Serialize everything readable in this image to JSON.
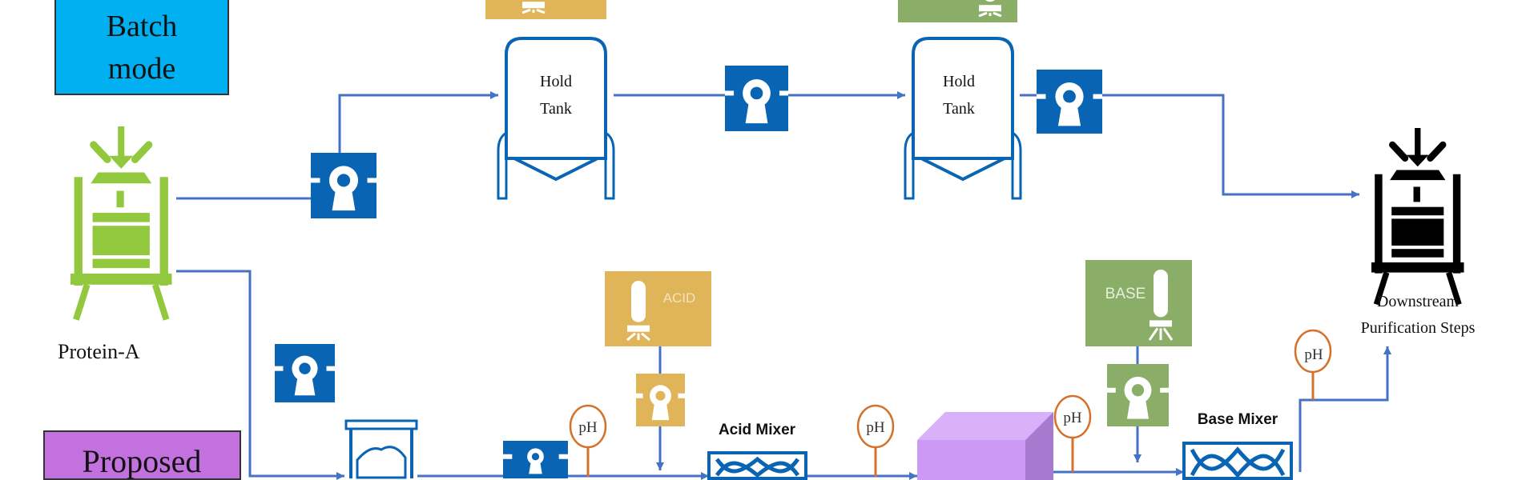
{
  "labels": {
    "batch_mode": [
      "Batch",
      "mode"
    ],
    "proposed": "Proposed",
    "protein_a": "Protein-A",
    "hold_tank": [
      "Hold",
      "Tank"
    ],
    "downstream": [
      "Downstream",
      "Purification Steps"
    ],
    "acid": "ACID",
    "base": "BASE",
    "acid_mixer": "Acid Mixer",
    "base_mixer": "Base Mixer",
    "ph": "pH"
  },
  "colors": {
    "batch_box": "#00b0f0",
    "proposed_box": "#c471e0",
    "pump_blue": "#0a64b4",
    "line_blue": "#4472c4",
    "acid_gold": "#e0b55a",
    "base_green": "#8aae68",
    "protein_a_green": "#92c83e",
    "ph_orange": "#d4712a",
    "cube_purple": "#cc99f5",
    "downstream_black": "#000000"
  }
}
